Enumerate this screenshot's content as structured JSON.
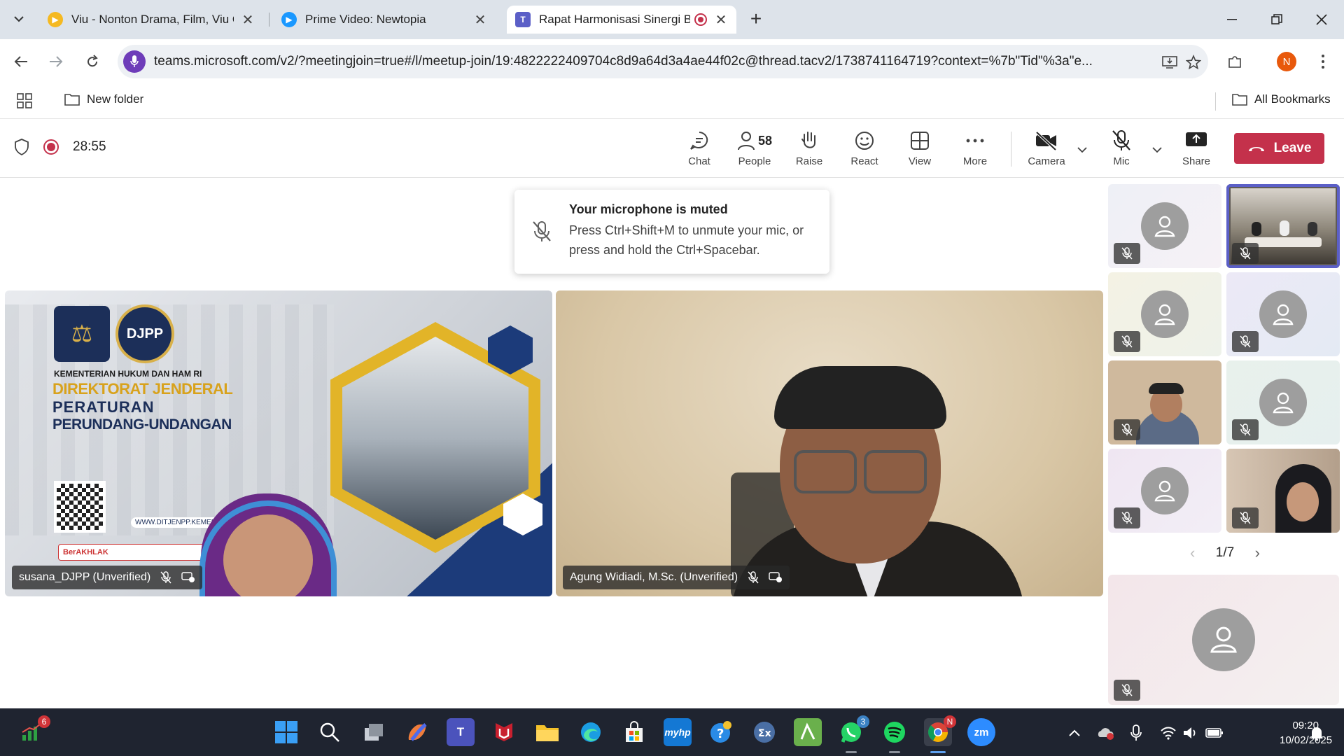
{
  "browser": {
    "tabs": [
      {
        "title": "Viu - Nonton Drama, Film, Viu O",
        "favicon": "viu-icon",
        "color": "#f5b921"
      },
      {
        "title": "Prime Video: Newtopia",
        "favicon": "prime-video-icon",
        "color": "#1a98ff"
      },
      {
        "title": "Rapat Harmonisasi Sinergi B",
        "favicon": "teams-icon",
        "color": "#5b5fc7",
        "recording": true
      }
    ],
    "url": "teams.microsoft.com/v2/?meetingjoin=true#/l/meetup-join/19:4822222409704c8d9a64d3a4ae44f02c@thread.tacv2/1738741164719?context=%7b\"Tid\"%3a\"e...",
    "profile_initial": "N",
    "bookmarks": {
      "folder": "New folder",
      "all": "All Bookmarks"
    }
  },
  "meeting": {
    "timer": "28:55",
    "controls": {
      "chat": "Chat",
      "people": "People",
      "people_count": "58",
      "raise": "Raise",
      "react": "React",
      "view": "View",
      "more": "More",
      "camera": "Camera",
      "mic": "Mic",
      "share": "Share",
      "leave": "Leave"
    },
    "toast": {
      "title": "Your microphone is muted",
      "body": "Press Ctrl+Shift+M to unmute your mic, or press and hold the Ctrl+Spacebar."
    },
    "participants": {
      "main": [
        {
          "name": "susana_DJPP (Unverified)"
        },
        {
          "name": "Agung Widiadi, M.Sc. (Unverified)"
        }
      ]
    },
    "slide": {
      "logo2": "DJPP",
      "ministry": "KEMENTERIAN HUKUM DAN HAM RI",
      "line1": "DIREKTORAT JENDERAL",
      "line2": "PERATURAN",
      "line3": "PERUNDANG-UNDANGAN",
      "website": "WWW.DITJENPP.KEMENK",
      "strip": "BerAKHLAK"
    },
    "pager": "1/7"
  },
  "taskbar": {
    "time": "09:20",
    "date": "10/02/2025",
    "badges": {
      "stocks": "6",
      "whatsapp": "3",
      "chrome": "N"
    }
  },
  "colors": {
    "teams_accent": "#5b5fc7",
    "leave_red": "#c4314b",
    "recording_red": "#c4314b"
  }
}
